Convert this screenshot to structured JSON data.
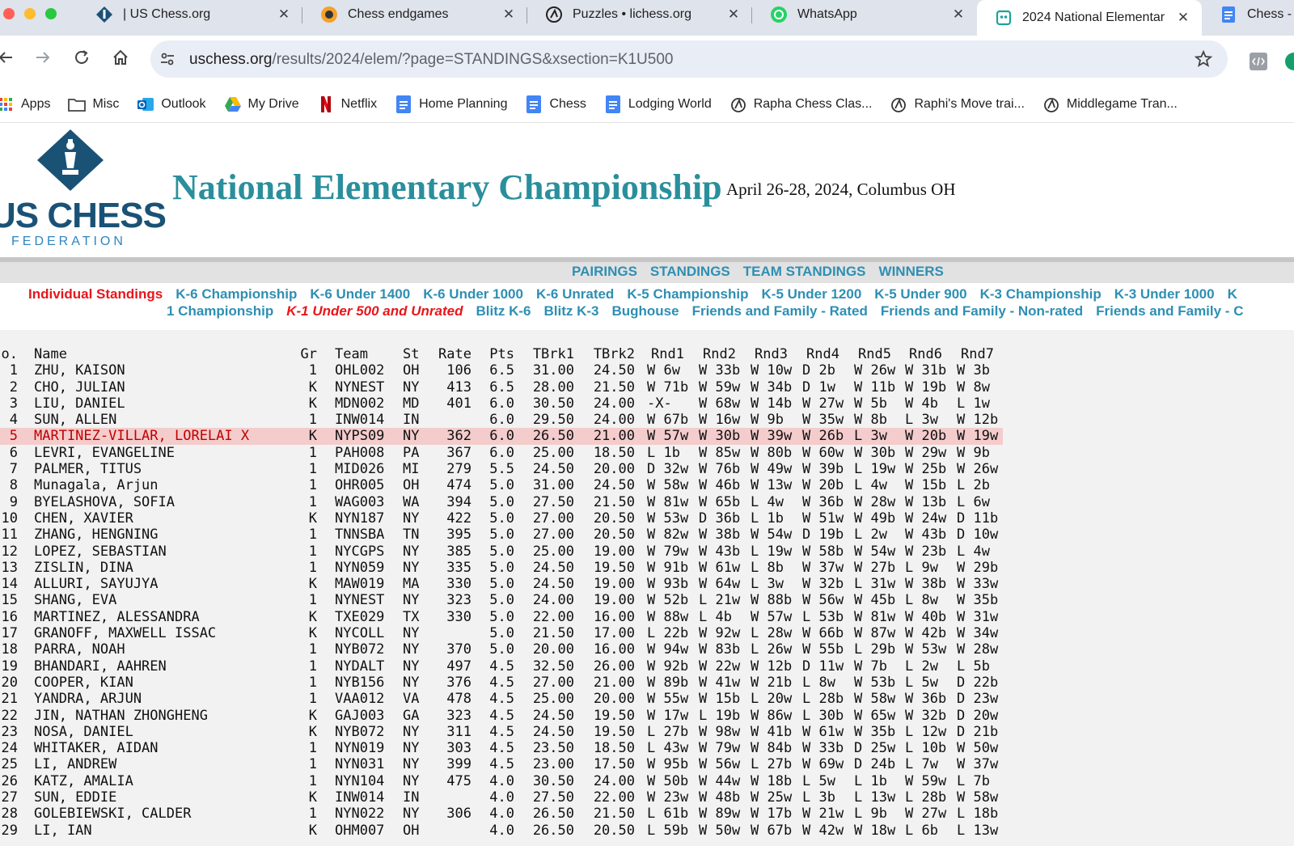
{
  "browser": {
    "tabs": [
      {
        "title": "| US Chess.org",
        "icon": "uschess-favicon"
      },
      {
        "title": "Chess endgames",
        "icon": "chess-endgames-favicon"
      },
      {
        "title": "Puzzles • lichess.org",
        "icon": "lichess-favicon"
      },
      {
        "title": "WhatsApp",
        "icon": "whatsapp-favicon"
      },
      {
        "title": "2024 National Elementar",
        "icon": "robot-favicon",
        "active": true
      },
      {
        "title": "Chess - G",
        "icon": "docs-favicon"
      }
    ],
    "tab_close": "✕",
    "url_host": "uschess.org",
    "url_path": "/results/2024/elem/?page=STANDINGS&xsection=K1U500",
    "bookmarks": [
      {
        "label": "Apps",
        "icon": "apps-grid-icon"
      },
      {
        "label": "Misc",
        "icon": "folder-icon"
      },
      {
        "label": "Outlook",
        "icon": "outlook-icon"
      },
      {
        "label": "My Drive",
        "icon": "drive-icon"
      },
      {
        "label": "Netflix",
        "icon": "netflix-icon"
      },
      {
        "label": "Home Planning",
        "icon": "docs-icon"
      },
      {
        "label": "Chess",
        "icon": "docs-icon"
      },
      {
        "label": "Lodging World",
        "icon": "docs-icon"
      },
      {
        "label": "Rapha Chess Clas...",
        "icon": "lichess-icon"
      },
      {
        "label": "Raphi's Move trai...",
        "icon": "lichess-icon"
      },
      {
        "label": "Middlegame Tran...",
        "icon": "lichess-icon"
      }
    ]
  },
  "page": {
    "logo_main": "US CHESS",
    "logo_sub": "FEDERATION",
    "title": "National Elementary Championship",
    "date_location": "April 26-28, 2024, Columbus OH",
    "top_nav": [
      "PAIRINGS",
      "STANDINGS",
      "TEAM STANDINGS",
      "WINNERS"
    ],
    "section_row1": [
      "Individual Standings",
      "K-6 Championship",
      "K-6 Under 1400",
      "K-6 Under 1000",
      "K-6 Unrated",
      "K-5 Championship",
      "K-5 Under 1200",
      "K-5 Under 900",
      "K-3 Championship",
      "K-3 Under 1000",
      "K"
    ],
    "section_row2": [
      "1 Championship",
      "K-1 Under 500 and Unrated",
      "Blitz K-6",
      "Blitz K-3",
      "Bughouse",
      "Friends and Family - Rated",
      "Friends and Family - Non-rated",
      "Friends and Family - C"
    ],
    "headers": {
      "no": "o.",
      "name": "Name",
      "gr": "Gr",
      "team": "Team",
      "st": "St",
      "rate": "Rate",
      "pts": "Pts",
      "tbrk1": "TBrk1",
      "tbrk2": "TBrk2",
      "rounds": [
        "Rnd1",
        "Rnd2",
        "Rnd3",
        "Rnd4",
        "Rnd5",
        "Rnd6",
        "Rnd7"
      ]
    },
    "standings": [
      {
        "no": "1",
        "name": "ZHU, KAISON",
        "gr": "1",
        "team": "OHL002",
        "st": "OH",
        "rate": "106",
        "pts": "6.5",
        "t1": "31.00",
        "t2": "24.50",
        "r": [
          "W 6w",
          "W 33b",
          "W 10w",
          "D 2b",
          "W 26w",
          "W 31b",
          "W 3b"
        ]
      },
      {
        "no": "2",
        "name": "CHO, JULIAN",
        "gr": "K",
        "team": "NYNEST",
        "st": "NY",
        "rate": "413",
        "pts": "6.5",
        "t1": "28.00",
        "t2": "21.50",
        "r": [
          "W 71b",
          "W 59w",
          "W 34b",
          "D 1w",
          "W 11b",
          "W 19b",
          "W 8w"
        ]
      },
      {
        "no": "3",
        "name": "LIU, DANIEL",
        "gr": "K",
        "team": "MDN002",
        "st": "MD",
        "rate": "401",
        "pts": "6.0",
        "t1": "30.50",
        "t2": "24.00",
        "r": [
          "-X-",
          "W 68w",
          "W 14b",
          "W 27w",
          "W 5b",
          "W 4b",
          "L 1w"
        ]
      },
      {
        "no": "4",
        "name": "SUN, ALLEN",
        "gr": "1",
        "team": "INW014",
        "st": "IN",
        "rate": "",
        "pts": "6.0",
        "t1": "29.50",
        "t2": "24.00",
        "r": [
          "W 67b",
          "W 16w",
          "W 9b",
          "W 35w",
          "W 8b",
          "L 3w",
          "W 12b"
        ]
      },
      {
        "no": "5",
        "name": "MARTINEZ-VILLAR, LORELAI X",
        "gr": "K",
        "team": "NYPS09",
        "st": "NY",
        "rate": "362",
        "pts": "6.0",
        "t1": "26.50",
        "t2": "21.00",
        "r": [
          "W 57w",
          "W 30b",
          "W 39w",
          "W 26b",
          "L 3w",
          "W 20b",
          "W 19w"
        ],
        "highlight": true
      },
      {
        "no": "6",
        "name": "LEVRI, EVANGELINE",
        "gr": "1",
        "team": "PAH008",
        "st": "PA",
        "rate": "367",
        "pts": "6.0",
        "t1": "25.00",
        "t2": "18.50",
        "r": [
          "L 1b",
          "W 85w",
          "W 80b",
          "W 60w",
          "W 30b",
          "W 29w",
          "W 9b"
        ]
      },
      {
        "no": "7",
        "name": "PALMER, TITUS",
        "gr": "1",
        "team": "MID026",
        "st": "MI",
        "rate": "279",
        "pts": "5.5",
        "t1": "24.50",
        "t2": "20.00",
        "r": [
          "D 32w",
          "W 76b",
          "W 49w",
          "W 39b",
          "L 19w",
          "W 25b",
          "W 26w"
        ]
      },
      {
        "no": "8",
        "name": "Munagala, Arjun",
        "gr": "1",
        "team": "OHR005",
        "st": "OH",
        "rate": "474",
        "pts": "5.0",
        "t1": "31.00",
        "t2": "24.50",
        "r": [
          "W 58w",
          "W 46b",
          "W 13w",
          "W 20b",
          "L 4w",
          "W 15b",
          "L 2b"
        ]
      },
      {
        "no": "9",
        "name": "BYELASHOVA, SOFIA",
        "gr": "1",
        "team": "WAG003",
        "st": "WA",
        "rate": "394",
        "pts": "5.0",
        "t1": "27.50",
        "t2": "21.50",
        "r": [
          "W 81w",
          "W 65b",
          "L 4w",
          "W 36b",
          "W 28w",
          "W 13b",
          "L 6w"
        ]
      },
      {
        "no": "10",
        "name": "CHEN, XAVIER",
        "gr": "K",
        "team": "NYN187",
        "st": "NY",
        "rate": "422",
        "pts": "5.0",
        "t1": "27.00",
        "t2": "20.50",
        "r": [
          "W 53w",
          "D 36b",
          "L 1b",
          "W 51w",
          "W 49b",
          "W 24w",
          "D 11b"
        ]
      },
      {
        "no": "11",
        "name": "ZHANG, HENGNING",
        "gr": "1",
        "team": "TNNSBA",
        "st": "TN",
        "rate": "395",
        "pts": "5.0",
        "t1": "27.00",
        "t2": "20.50",
        "r": [
          "W 82w",
          "W 38b",
          "W 54w",
          "D 19b",
          "L 2w",
          "W 43b",
          "D 10w"
        ]
      },
      {
        "no": "12",
        "name": "LOPEZ, SEBASTIAN",
        "gr": "1",
        "team": "NYCGPS",
        "st": "NY",
        "rate": "385",
        "pts": "5.0",
        "t1": "25.00",
        "t2": "19.00",
        "r": [
          "W 79w",
          "W 43b",
          "L 19w",
          "W 58b",
          "W 54w",
          "W 23b",
          "L 4w"
        ]
      },
      {
        "no": "13",
        "name": "ZISLIN, DINA",
        "gr": "1",
        "team": "NYN059",
        "st": "NY",
        "rate": "335",
        "pts": "5.0",
        "t1": "24.50",
        "t2": "19.50",
        "r": [
          "W 91b",
          "W 61w",
          "L 8b",
          "W 37w",
          "W 27b",
          "L 9w",
          "W 29b"
        ]
      },
      {
        "no": "14",
        "name": "ALLURI, SAYUJYA",
        "gr": "K",
        "team": "MAW019",
        "st": "MA",
        "rate": "330",
        "pts": "5.0",
        "t1": "24.50",
        "t2": "19.00",
        "r": [
          "W 93b",
          "W 64w",
          "L 3w",
          "W 32b",
          "L 31w",
          "W 38b",
          "W 33w"
        ]
      },
      {
        "no": "15",
        "name": "SHANG, EVA",
        "gr": "1",
        "team": "NYNEST",
        "st": "NY",
        "rate": "323",
        "pts": "5.0",
        "t1": "24.00",
        "t2": "19.00",
        "r": [
          "W 52b",
          "L 21w",
          "W 88b",
          "W 56w",
          "W 45b",
          "L 8w",
          "W 35b"
        ]
      },
      {
        "no": "16",
        "name": "MARTINEZ, ALESSANDRA",
        "gr": "K",
        "team": "TXE029",
        "st": "TX",
        "rate": "330",
        "pts": "5.0",
        "t1": "22.00",
        "t2": "16.00",
        "r": [
          "W 88w",
          "L 4b",
          "W 57w",
          "L 53b",
          "W 81w",
          "W 40b",
          "W 31w"
        ]
      },
      {
        "no": "17",
        "name": "GRANOFF, MAXWELL ISSAC",
        "gr": "K",
        "team": "NYCOLL",
        "st": "NY",
        "rate": "",
        "pts": "5.0",
        "t1": "21.50",
        "t2": "17.00",
        "r": [
          "L 22b",
          "W 92w",
          "L 28w",
          "W 66b",
          "W 87w",
          "W 42b",
          "W 34w"
        ]
      },
      {
        "no": "18",
        "name": "PARRA, NOAH",
        "gr": "1",
        "team": "NYB072",
        "st": "NY",
        "rate": "370",
        "pts": "5.0",
        "t1": "20.00",
        "t2": "16.00",
        "r": [
          "W 94w",
          "W 83b",
          "L 26w",
          "W 55b",
          "L 29b",
          "W 53w",
          "W 28w"
        ]
      },
      {
        "no": "19",
        "name": "BHANDARI, AAHREN",
        "gr": "1",
        "team": "NYDALT",
        "st": "NY",
        "rate": "497",
        "pts": "4.5",
        "t1": "32.50",
        "t2": "26.00",
        "r": [
          "W 92b",
          "W 22w",
          "W 12b",
          "D 11w",
          "W 7b",
          "L 2w",
          "L 5b"
        ]
      },
      {
        "no": "20",
        "name": "COOPER, KIAN",
        "gr": "1",
        "team": "NYB156",
        "st": "NY",
        "rate": "376",
        "pts": "4.5",
        "t1": "27.00",
        "t2": "21.00",
        "r": [
          "W 89b",
          "W 41w",
          "W 21b",
          "L 8w",
          "W 53b",
          "L 5w",
          "D 22b"
        ]
      },
      {
        "no": "21",
        "name": "YANDRA, ARJUN",
        "gr": "1",
        "team": "VAA012",
        "st": "VA",
        "rate": "478",
        "pts": "4.5",
        "t1": "25.00",
        "t2": "20.00",
        "r": [
          "W 55w",
          "W 15b",
          "L 20w",
          "L 28b",
          "W 58w",
          "W 36b",
          "D 23w"
        ]
      },
      {
        "no": "22",
        "name": "JIN, NATHAN ZHONGHENG",
        "gr": "K",
        "team": "GAJ003",
        "st": "GA",
        "rate": "323",
        "pts": "4.5",
        "t1": "24.50",
        "t2": "19.50",
        "r": [
          "W 17w",
          "L 19b",
          "W 86w",
          "L 30b",
          "W 65w",
          "W 32b",
          "D 20w"
        ]
      },
      {
        "no": "23",
        "name": "NOSA, DANIEL",
        "gr": "K",
        "team": "NYB072",
        "st": "NY",
        "rate": "311",
        "pts": "4.5",
        "t1": "24.50",
        "t2": "19.50",
        "r": [
          "L 27b",
          "W 98w",
          "W 41b",
          "W 61w",
          "W 35b",
          "L 12w",
          "D 21b"
        ]
      },
      {
        "no": "24",
        "name": "WHITAKER, AIDAN",
        "gr": "1",
        "team": "NYN019",
        "st": "NY",
        "rate": "303",
        "pts": "4.5",
        "t1": "23.50",
        "t2": "18.50",
        "r": [
          "L 43w",
          "W 79w",
          "W 84b",
          "W 33b",
          "D 25w",
          "L 10b",
          "W 50w"
        ]
      },
      {
        "no": "25",
        "name": "LI, ANDREW",
        "gr": "1",
        "team": "NYN031",
        "st": "NY",
        "rate": "399",
        "pts": "4.5",
        "t1": "23.00",
        "t2": "17.50",
        "r": [
          "W 95b",
          "W 56w",
          "L 27b",
          "W 69w",
          "D 24b",
          "L 7w",
          "W 37w"
        ]
      },
      {
        "no": "26",
        "name": "KATZ, AMALIA",
        "gr": "1",
        "team": "NYN104",
        "st": "NY",
        "rate": "475",
        "pts": "4.0",
        "t1": "30.50",
        "t2": "24.00",
        "r": [
          "W 50b",
          "W 44w",
          "W 18b",
          "L 5w",
          "L 1b",
          "W 59w",
          "L 7b"
        ]
      },
      {
        "no": "27",
        "name": "SUN, EDDIE",
        "gr": "K",
        "team": "INW014",
        "st": "IN",
        "rate": "",
        "pts": "4.0",
        "t1": "27.50",
        "t2": "22.00",
        "r": [
          "W 23w",
          "W 48b",
          "W 25w",
          "L 3b",
          "L 13w",
          "L 28b",
          "W 58w"
        ]
      },
      {
        "no": "28",
        "name": "GOLEBIEWSKI, CALDER",
        "gr": "1",
        "team": "NYN022",
        "st": "NY",
        "rate": "306",
        "pts": "4.0",
        "t1": "26.50",
        "t2": "21.50",
        "r": [
          "L 61b",
          "W 89w",
          "W 17b",
          "W 21w",
          "L 9b",
          "W 27w",
          "L 18b"
        ]
      },
      {
        "no": "29",
        "name": "LI, IAN",
        "gr": "K",
        "team": "OHM007",
        "st": "OH",
        "rate": "",
        "pts": "4.0",
        "t1": "26.50",
        "t2": "20.50",
        "r": [
          "L 59b",
          "W 50w",
          "W 67b",
          "W 42w",
          "W 18w",
          "L 6b",
          "L 13w"
        ]
      }
    ]
  },
  "colors": {
    "accent_teal": "#2a8f9c",
    "link_blue": "#2e8fb3",
    "current_red": "#e8161b",
    "highlight_row": "#f4cccc"
  }
}
